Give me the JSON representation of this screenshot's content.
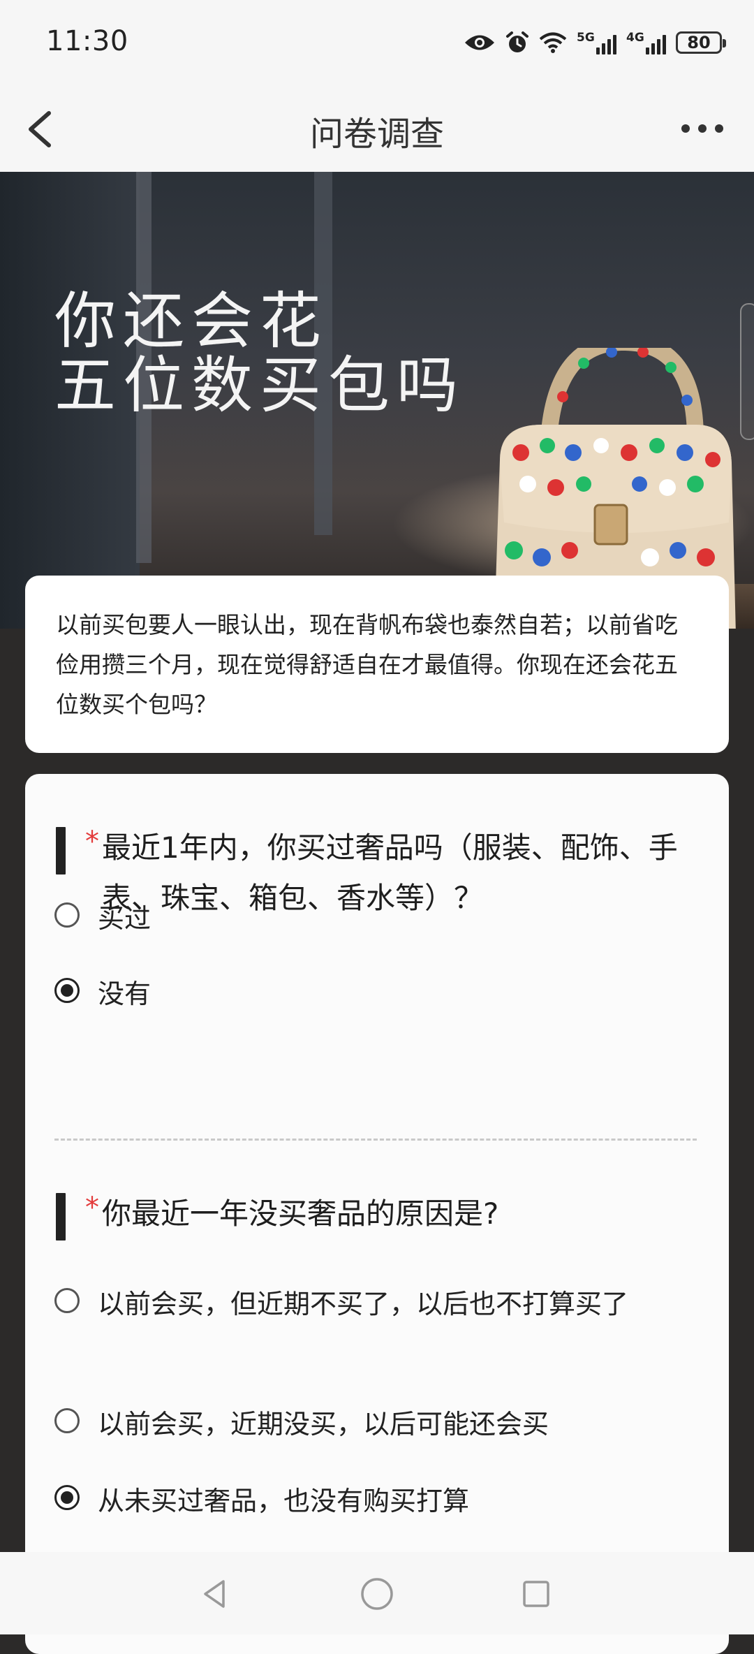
{
  "status_bar": {
    "time": "11:30",
    "network1": "5G",
    "network2": "4G",
    "battery": "80",
    "icons": [
      "eye-icon",
      "alarm-icon",
      "wifi-icon",
      "signal-icon",
      "signal-icon",
      "battery-icon"
    ]
  },
  "nav": {
    "title": "问卷调查",
    "back_icon": "back-chevron-icon",
    "more_icon": "more-icon"
  },
  "banner": {
    "line1": "你还会花",
    "line2": "五位数买包吗",
    "image": "jeweled-handbag-illustration"
  },
  "intro": {
    "text": "以前买包要人一眼认出，现在背帆布袋也泰然自若；以前省吃俭用攒三个月，现在觉得舒适自在才最值得。你现在还会花五位数买个包吗？"
  },
  "questions": [
    {
      "required_mark": "*",
      "title": "最近1年内，你买过奢品吗（服装、配饰、手表、珠宝、箱包、香水等）？",
      "options": [
        {
          "label": "买过",
          "selected": false
        },
        {
          "label": "没有",
          "selected": true
        }
      ]
    },
    {
      "required_mark": "*",
      "title": "你最近一年没买奢品的原因是?",
      "options": [
        {
          "label": "以前会买，但近期不买了，以后也不打算买了",
          "selected": false
        },
        {
          "label": "以前会买，近期没买，以后可能还会买",
          "selected": false
        },
        {
          "label": "从未买过奢品，也没有购买打算",
          "selected": true
        }
      ]
    }
  ],
  "system_nav": {
    "back": "triangle-back-icon",
    "home": "circle-home-icon",
    "recents": "square-recents-icon"
  },
  "colors": {
    "required": "#e33b3b",
    "page_bg": "#2c2a29",
    "card_bg": "#ffffff"
  }
}
